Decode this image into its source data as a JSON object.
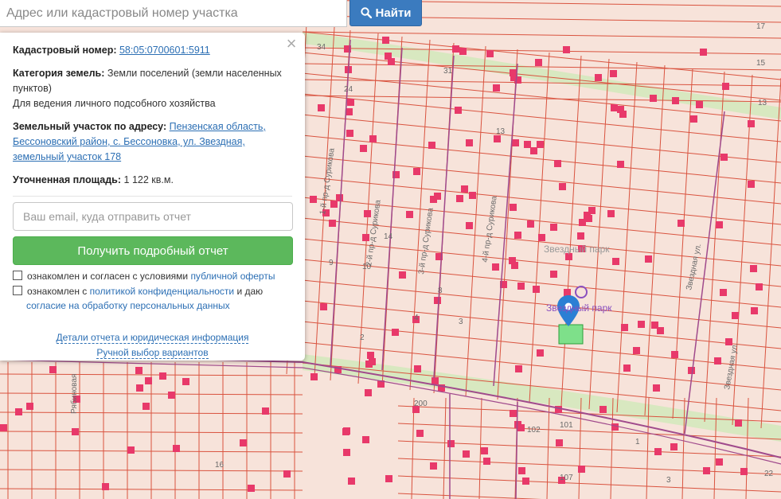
{
  "search": {
    "placeholder": "Адрес или кадастровый номер участка",
    "button_label": "Найти"
  },
  "popup": {
    "cadastral_label": "Кадастровый номер:",
    "cadastral_value": "58:05:0700601:5911",
    "category_label": "Категория земель:",
    "category_value": "Земли поселений (земли населенных пунктов)",
    "usage": "Для ведения личного подсобного хозяйства",
    "address_label": "Земельный участок по адресу:",
    "address_value": "Пензенская область, Бессоновский район, с. Бессоновка, ул. Звездная, земельный участок 178",
    "area_label": "Уточненная площадь:",
    "area_value": "1 122 кв.м.",
    "email_placeholder": "Ваш email, куда отправить отчет",
    "report_button": "Получить подробный отчет",
    "consent1_text": "ознакомлен и согласен с условиями ",
    "consent1_link": "публичной оферты",
    "consent2_text": "ознакомлен с ",
    "consent2_link1": "политикой конфиденциальности",
    "consent2_mid": " и даю",
    "consent2_link2": "согласие на обработку персональных данных",
    "details_link": "Детали отчета и юридическая информация",
    "manual_link": "Ручной выбор вариантов"
  },
  "map": {
    "street_labels": [
      "ул. Звездная",
      "Звездная ул.",
      "Звездная ул.",
      "Рябиновая",
      "1-й пр-д Сурикова",
      "2-й пр-д Сурикова",
      "3-й пр-д Сурикова",
      "4-й пр-д Сурикова"
    ],
    "park_labels": [
      "Звездный парк",
      "Звездный парк"
    ],
    "house_numbers": [
      "34",
      "31",
      "24",
      "13",
      "14",
      "10",
      "9",
      "8",
      "4",
      "2",
      "3",
      "17",
      "15",
      "13",
      "16",
      "101",
      "102",
      "107",
      "1",
      "3",
      "22",
      "200"
    ]
  },
  "colors": {
    "parcel_fill": "#f7e3da",
    "parcel_line": "#d9533f",
    "building": "#e8396a",
    "road_green": "#d8e8c0",
    "road_purple": "#a04a8c",
    "selected_parcel": "#7ee08a",
    "marker": "#2b7fd4",
    "accent_button": "#5cb85c",
    "search_button": "#3b7bbf"
  }
}
